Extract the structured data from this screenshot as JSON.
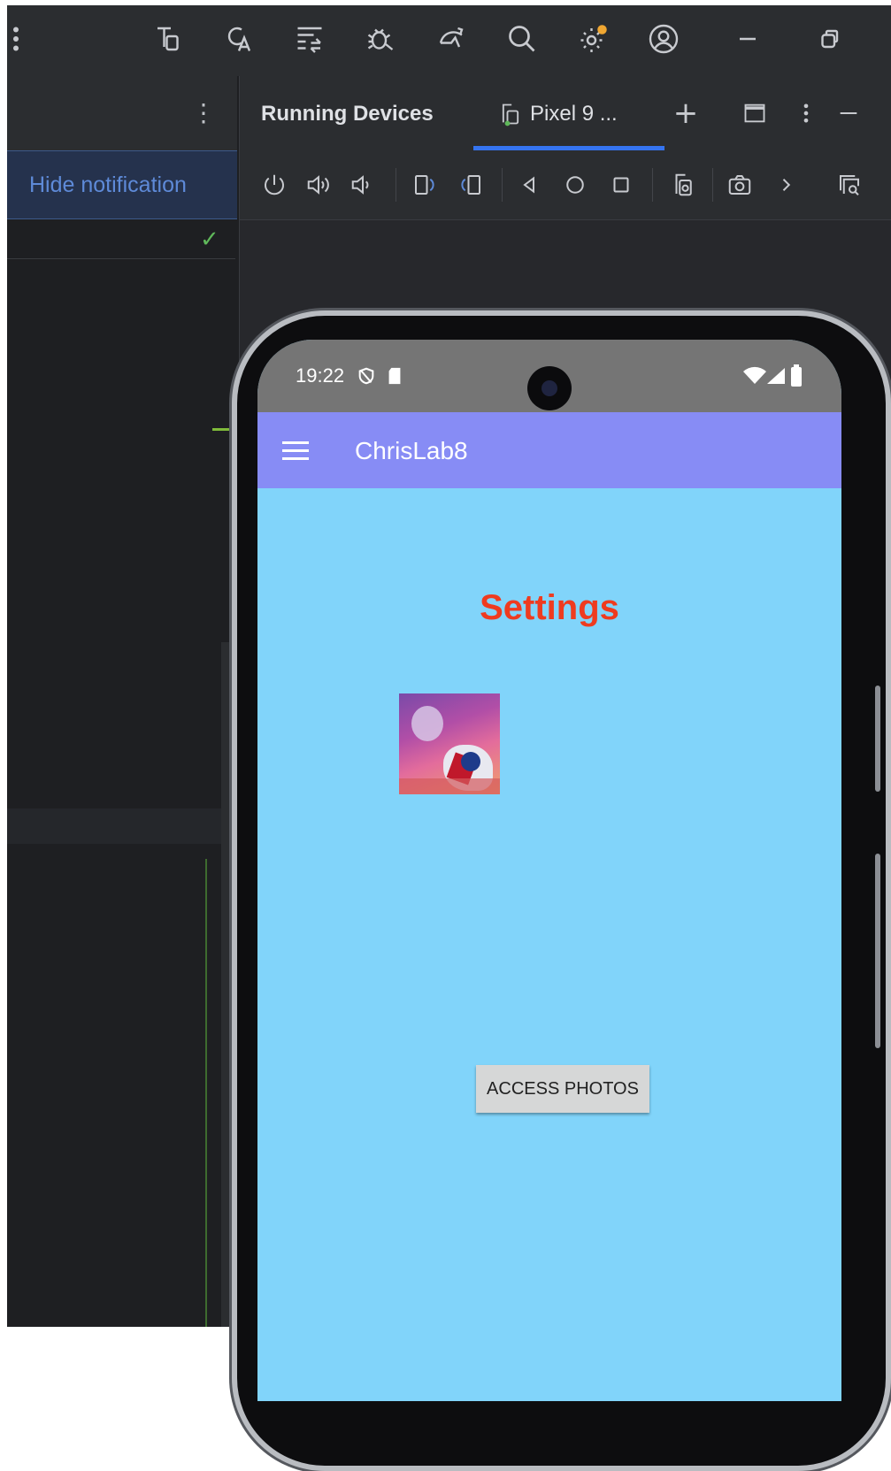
{
  "left_panel": {
    "hide_notification_label": "Hide notification"
  },
  "running_devices": {
    "title": "Running Devices",
    "tab_label": "Pixel 9 ...",
    "add_label": "+"
  },
  "phone": {
    "status_time": "19:22",
    "app_title": "ChrisLab8",
    "page_heading": "Settings",
    "button_label": "ACCESS PHOTOS"
  },
  "colors": {
    "ide_background": "#1e1f22",
    "panel_header": "#2b2d30",
    "accent_blue": "#3574f0",
    "app_bar": "#878cf5",
    "screen_background": "#81d4fa",
    "heading_red": "#ef3b1f"
  }
}
